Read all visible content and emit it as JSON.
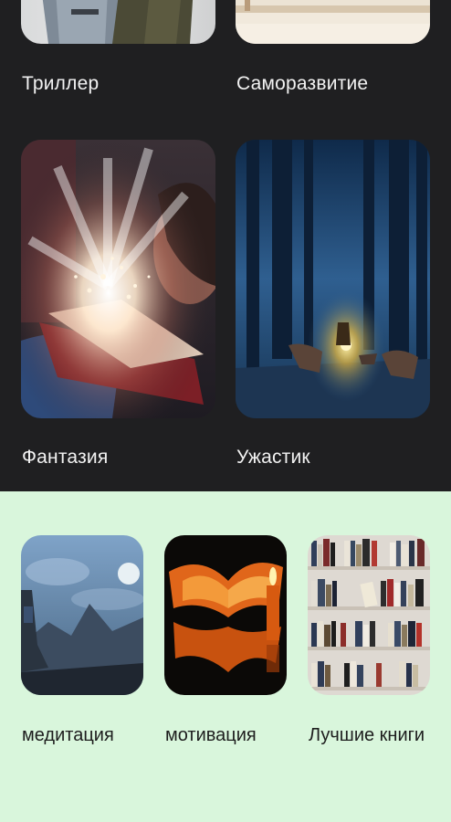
{
  "top_section": {
    "categories": [
      {
        "label": "Триллер",
        "image": "thriller-cover"
      },
      {
        "label": "Саморазвитие",
        "image": "self-development-cover"
      },
      {
        "label": "Фантазия",
        "image": "fantasy-cover"
      },
      {
        "label": "Ужастик",
        "image": "horror-cover"
      }
    ]
  },
  "bottom_section": {
    "categories": [
      {
        "label": "медитация",
        "image": "meditation-cover"
      },
      {
        "label": "мотивация",
        "image": "motivation-cover"
      },
      {
        "label": "Лучшие книги",
        "image": "best-books-cover"
      }
    ]
  },
  "colors": {
    "dark_bg": "#1f1f21",
    "light_bg": "#d9f6dc",
    "label_light": "#f2f2f2",
    "label_dark": "#1d1d1d"
  }
}
